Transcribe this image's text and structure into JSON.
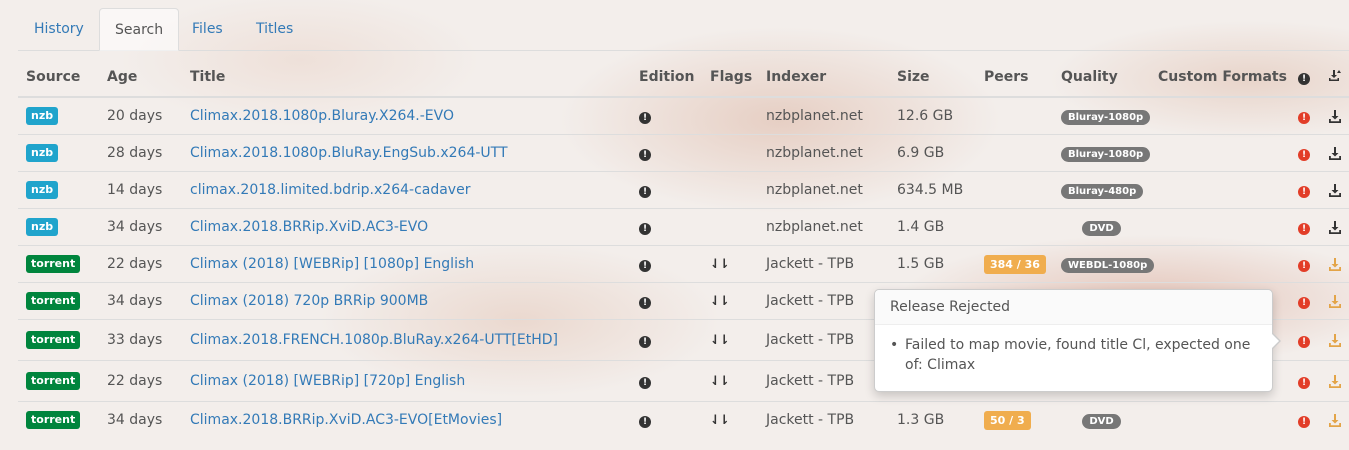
{
  "tabs": [
    "History",
    "Search",
    "Files",
    "Titles"
  ],
  "active_tab": "Search",
  "columns": {
    "source": "Source",
    "age": "Age",
    "title": "Title",
    "edition": "Edition",
    "flags": "Flags",
    "indexer": "Indexer",
    "size": "Size",
    "peers": "Peers",
    "quality": "Quality",
    "custom_formats": "Custom Formats"
  },
  "rows": [
    {
      "source": "nzb",
      "age": "20 days",
      "title": "Climax.2018.1080p.Bluray.X264.-EVO",
      "flags": "",
      "indexer": "nzbplanet.net",
      "size": "12.6 GB",
      "peers": "",
      "quality": "Bluray-1080p"
    },
    {
      "source": "nzb",
      "age": "28 days",
      "title": "Climax.2018.1080p.BluRay.EngSub.x264-UTT",
      "flags": "",
      "indexer": "nzbplanet.net",
      "size": "6.9 GB",
      "peers": "",
      "quality": "Bluray-1080p"
    },
    {
      "source": "nzb",
      "age": "14 days",
      "title": "climax.2018.limited.bdrip.x264-cadaver",
      "flags": "",
      "indexer": "nzbplanet.net",
      "size": "634.5 MB",
      "peers": "",
      "quality": "Bluray-480p"
    },
    {
      "source": "nzb",
      "age": "34 days",
      "title": "Climax.2018.BRRip.XviD.AC3-EVO",
      "flags": "",
      "indexer": "nzbplanet.net",
      "size": "1.4 GB",
      "peers": "",
      "quality": "DVD"
    },
    {
      "source": "torrent",
      "age": "22 days",
      "title": "Climax (2018) [WEBRip] [1080p] English",
      "flags": "⇃⇂",
      "indexer": "Jackett - TPB",
      "size": "1.5 GB",
      "peers": "384 / 36",
      "quality": "WEBDL-1080p"
    },
    {
      "source": "torrent",
      "age": "34 days",
      "title": "Climax (2018) 720p BRRip 900MB",
      "flags": "⇃⇂",
      "indexer": "Jackett - TPB",
      "size": "",
      "peers": "",
      "quality": ""
    },
    {
      "source": "torrent",
      "age": "33 days",
      "title": "Climax.2018.FRENCH.1080p.BluRay.x264-UTT[EtHD]",
      "flags": "⇃⇂",
      "indexer": "Jackett - TPB",
      "size": "",
      "peers": "",
      "quality": ""
    },
    {
      "source": "torrent",
      "age": "22 days",
      "title": "Climax (2018) [WEBRip] [720p] English",
      "flags": "⇃⇂",
      "indexer": "Jackett - TPB",
      "size": "",
      "peers": "",
      "quality": ""
    },
    {
      "source": "torrent",
      "age": "34 days",
      "title": "Climax.2018.BRRip.XviD.AC3-EVO[EtMovies]",
      "flags": "⇃⇂",
      "indexer": "Jackett - TPB",
      "size": "1.3 GB",
      "peers": "50 / 3",
      "quality": "DVD"
    }
  ],
  "popover": {
    "title": "Release Rejected",
    "items": [
      "Failed to map movie, found title Cl, expected one of: Climax"
    ]
  },
  "colors": {
    "link": "#337ab7",
    "nzb": "#20a4cc",
    "torrent": "#00853d",
    "peers": "#f0ad4e",
    "quality": "#777777",
    "reject": "#e23d28",
    "download_torrent": "#e3a448"
  },
  "icons": {
    "edition": "exclamation-circle-icon",
    "reject": "exclamation-circle-icon",
    "download": "download-icon",
    "flags": "arrows-down-icon"
  }
}
